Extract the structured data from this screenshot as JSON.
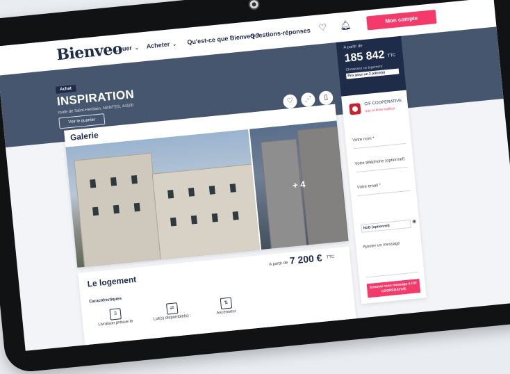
{
  "header": {
    "logo": "Bienveo",
    "nav": [
      {
        "label": "Louer",
        "caret": "⌄"
      },
      {
        "label": "Acheter",
        "caret": "⌄"
      },
      {
        "label": "Qu'est-ce que Bienveo ?",
        "caret": ""
      },
      {
        "label": "Questions-réponses",
        "caret": ""
      }
    ],
    "account_button": "Mon compte"
  },
  "hero": {
    "tag": "Achat",
    "title": "INSPIRATION",
    "address": "route de Saint-Herblain, NANTES, 44100",
    "quartier_button": "Voir le quartier"
  },
  "gallery": {
    "title": "Galerie",
    "more_count": "+ 4"
  },
  "logement": {
    "title": "Le logement",
    "price_prefix": "A partir de",
    "price": "7 200 €",
    "price_suffix": "TTC",
    "characteristics_label": "Caractéristiques",
    "features": [
      {
        "icon": "calendar-icon",
        "glyph": "3",
        "label": "Livraison prévue le"
      },
      {
        "icon": "lots-icon",
        "glyph": "⇄",
        "label": "Lot(s) disponible(s) :"
      },
      {
        "icon": "elevator-icon",
        "glyph": "⇅",
        "label": "Ascenseur"
      }
    ]
  },
  "sidebar": {
    "price_prefix": "A partir de",
    "price": "185 842",
    "price_suffix": "TTC",
    "subtext": "Choisissez un logement",
    "select_value": "Prix pour un 2 pièce(s)",
    "developer_name": "CIF COOPERATIVE",
    "developer_link": "Voir la fiche bailleur",
    "fields": {
      "name": "Votre nom *",
      "phone": "Votre téléphone (optionnel)",
      "email": "Votre email *",
      "nud": "NUD (optionnel)",
      "message": "Ajouter un message"
    },
    "send_button": "Envoyer mon message à CIF COOPERATIVE"
  },
  "colors": {
    "navy": "#1e2c4a",
    "accent": "#f43a6a",
    "hero_bg": "#46566e"
  }
}
